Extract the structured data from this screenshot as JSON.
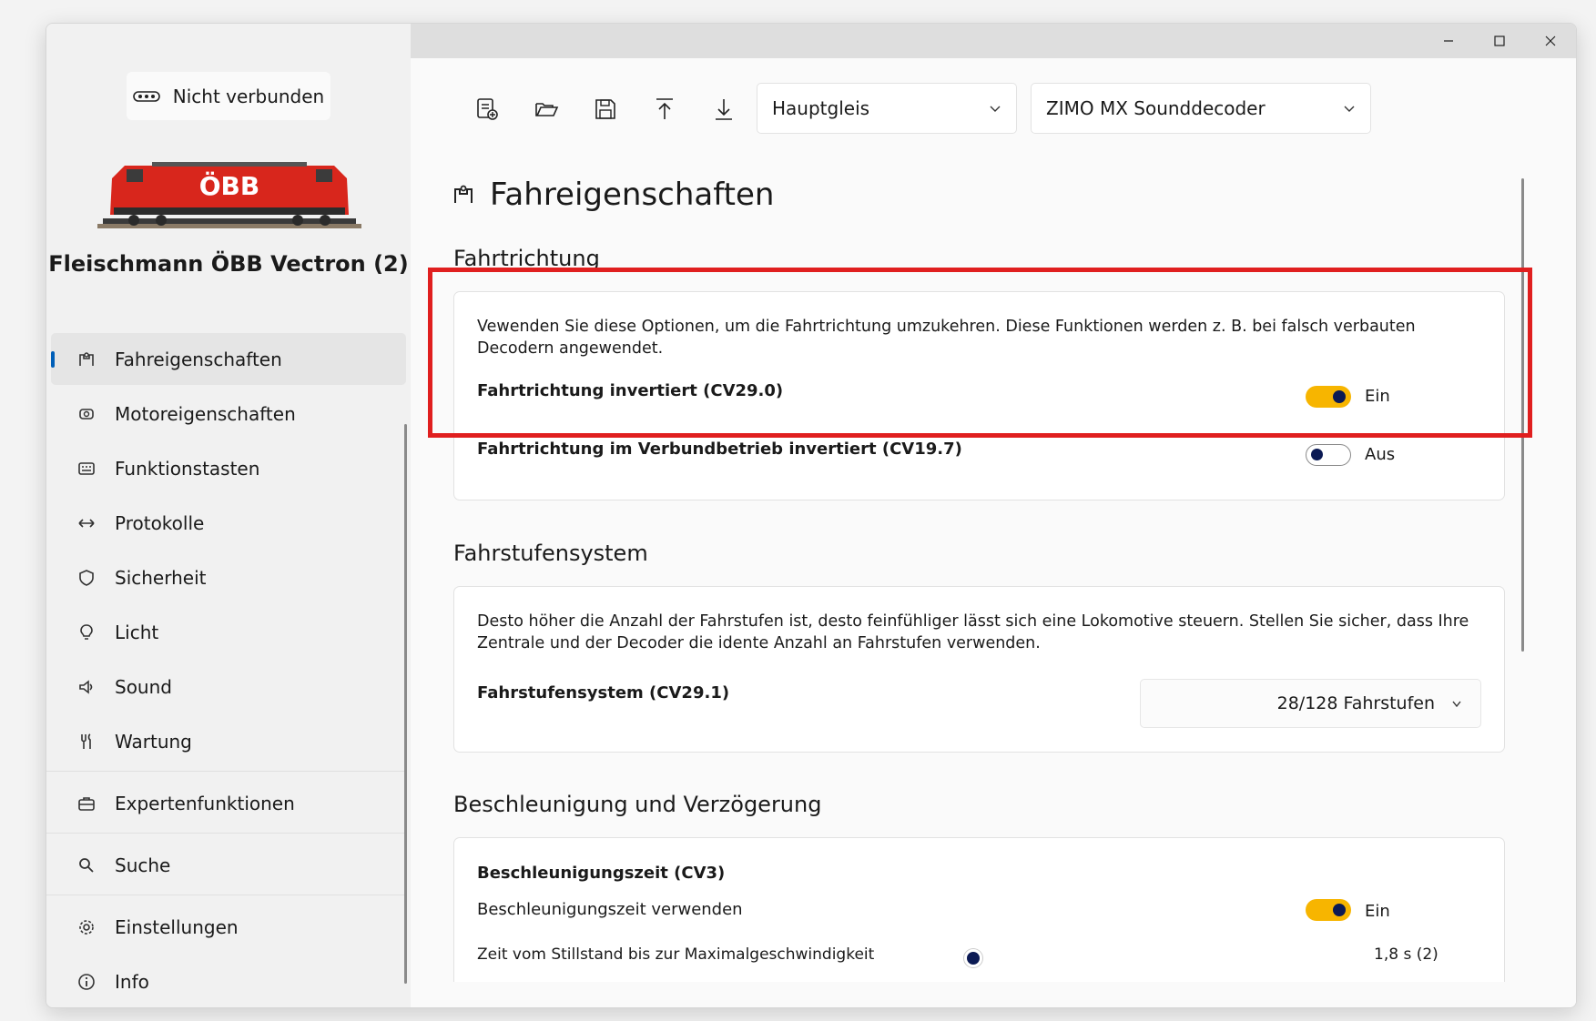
{
  "sidebar": {
    "connection_label": "Nicht verbunden",
    "loco_name": "Fleischmann ÖBB Vectron (2)",
    "loco_logo_text": "ÖBB",
    "items": [
      {
        "label": "Fahreigenschaften",
        "icon": "driving-icon"
      },
      {
        "label": "Motoreigenschaften",
        "icon": "motor-icon"
      },
      {
        "label": "Funktionstasten",
        "icon": "keypad-icon"
      },
      {
        "label": "Protokolle",
        "icon": "arrows-icon"
      },
      {
        "label": "Sicherheit",
        "icon": "shield-icon"
      },
      {
        "label": "Licht",
        "icon": "bulb-icon"
      },
      {
        "label": "Sound",
        "icon": "speaker-icon"
      },
      {
        "label": "Wartung",
        "icon": "wrench-icon"
      },
      {
        "label": "Expertenfunktionen",
        "icon": "toolbox-icon"
      },
      {
        "label": "Suche",
        "icon": "search-icon"
      },
      {
        "label": "Einstellungen",
        "icon": "gear-icon"
      },
      {
        "label": "Info",
        "icon": "info-icon"
      }
    ]
  },
  "toolbar": {
    "track_select": "Hauptgleis",
    "decoder_select": "ZIMO MX Sounddecoder"
  },
  "page": {
    "title": "Fahreigenschaften",
    "sections": {
      "direction": {
        "heading": "Fahrtrichtung",
        "description": "Vewenden Sie diese Optionen, um die Fahrtrichtung umzukehren. Diese Funktionen werden z. B. bei falsch verbauten Decodern angewendet.",
        "row1_label": "Fahrtrichtung invertiert (CV29.0)",
        "row1_state": "Ein",
        "row2_label": "Fahrtrichtung im Verbundbetrieb invertiert (CV19.7)",
        "row2_state": "Aus"
      },
      "speedsteps": {
        "heading": "Fahrstufensystem",
        "description": "Desto höher die Anzahl der Fahrstufen ist, desto feinfühliger lässt sich eine Lokomotive steuern. Stellen Sie sicher, dass Ihre Zentrale und der Decoder die idente Anzahl an Fahrstufen verwenden.",
        "row_label": "Fahrstufensystem (CV29.1)",
        "select_value": "28/128 Fahrstufen"
      },
      "acceleration": {
        "heading": "Beschleunigung und Verzögerung",
        "sub_heading": "Beschleunigungszeit (CV3)",
        "toggle_label": "Beschleunigungszeit verwenden",
        "toggle_state": "Ein",
        "slider_label": "Zeit vom Stillstand bis zur Maximalgeschwindigkeit",
        "slider_value": "1,8 s (2)"
      }
    }
  },
  "colors": {
    "accent": "#005fb8",
    "toggle_on": "#f7b500",
    "highlight": "#e01f1f"
  }
}
